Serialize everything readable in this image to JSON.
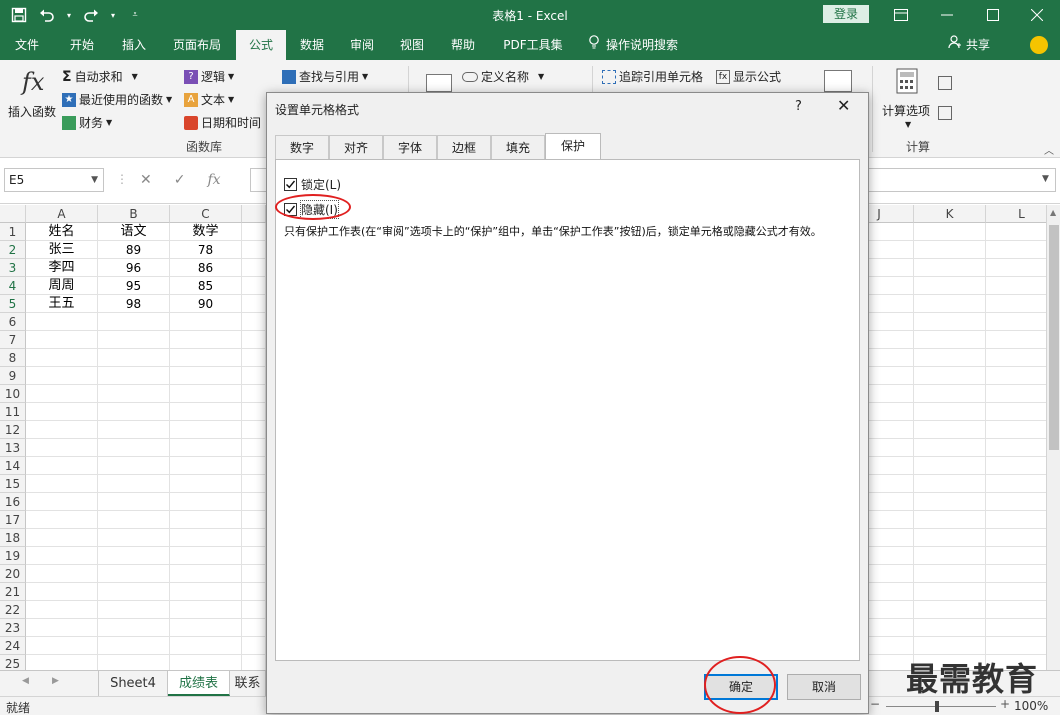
{
  "window": {
    "title": "表格1 - Excel",
    "login_label": "登录"
  },
  "ribbon_tabs": [
    {
      "label": "文件"
    },
    {
      "label": "开始"
    },
    {
      "label": "插入"
    },
    {
      "label": "页面布局"
    },
    {
      "label": "公式",
      "active": true
    },
    {
      "label": "数据"
    },
    {
      "label": "审阅"
    },
    {
      "label": "视图"
    },
    {
      "label": "帮助"
    },
    {
      "label": "PDF工具集"
    },
    {
      "label": "操作说明搜索"
    }
  ],
  "share_label": "共享",
  "ribbon": {
    "insert_function": "插入函数",
    "fx_glyph": "fx",
    "autosum": "自动求和",
    "recent": "最近使用的函数",
    "financial": "财务",
    "logical": "逻辑",
    "text": "文本",
    "datetime": "日期和时间",
    "lookup": "查找与引用",
    "define_name": "定义名称",
    "trace": "追踪引用单元格",
    "show_formula": "显示公式",
    "calc_options": "计算选项",
    "group_function_library": "函数库",
    "group_calculation": "计算"
  },
  "formula_bar": {
    "name_box": "E5",
    "fx_label": "fx"
  },
  "columns": [
    "A",
    "B",
    "C",
    "J",
    "K",
    "L"
  ],
  "rows": [
    "1",
    "2",
    "3",
    "4",
    "5",
    "6",
    "7",
    "8",
    "9",
    "10",
    "11",
    "12",
    "13",
    "14",
    "15",
    "16",
    "17",
    "18",
    "19",
    "20",
    "21",
    "22",
    "23",
    "24",
    "25"
  ],
  "table": {
    "headers": [
      "姓名",
      "语文",
      "数学"
    ],
    "rows": [
      [
        "张三",
        "89",
        "78"
      ],
      [
        "李四",
        "96",
        "86"
      ],
      [
        "周周",
        "95",
        "85"
      ],
      [
        "王五",
        "98",
        "90"
      ]
    ]
  },
  "sheet_tabs": [
    {
      "label": "Sheet4"
    },
    {
      "label": "成绩表",
      "active": true
    },
    {
      "label": "联系"
    }
  ],
  "status": {
    "ready": "就绪",
    "zoom": "100%"
  },
  "watermark": "最需教育",
  "dialog": {
    "title": "设置单元格格式",
    "help": "?",
    "tabs": [
      {
        "label": "数字"
      },
      {
        "label": "对齐"
      },
      {
        "label": "字体"
      },
      {
        "label": "边框"
      },
      {
        "label": "填充"
      },
      {
        "label": "保护",
        "active": true
      }
    ],
    "locked_label": "锁定(L)",
    "hidden_label": "隐藏(I)",
    "locked_checked": true,
    "hidden_checked": true,
    "note": "只有保护工作表(在“审阅”选项卡上的“保护”组中，单击“保护工作表”按钮)后，锁定单元格或隐藏公式才有效。",
    "ok_label": "确定",
    "cancel_label": "取消"
  },
  "colors": {
    "excel_green": "#217346",
    "annotation_red": "#e02020",
    "focus_blue": "#0078d7"
  }
}
